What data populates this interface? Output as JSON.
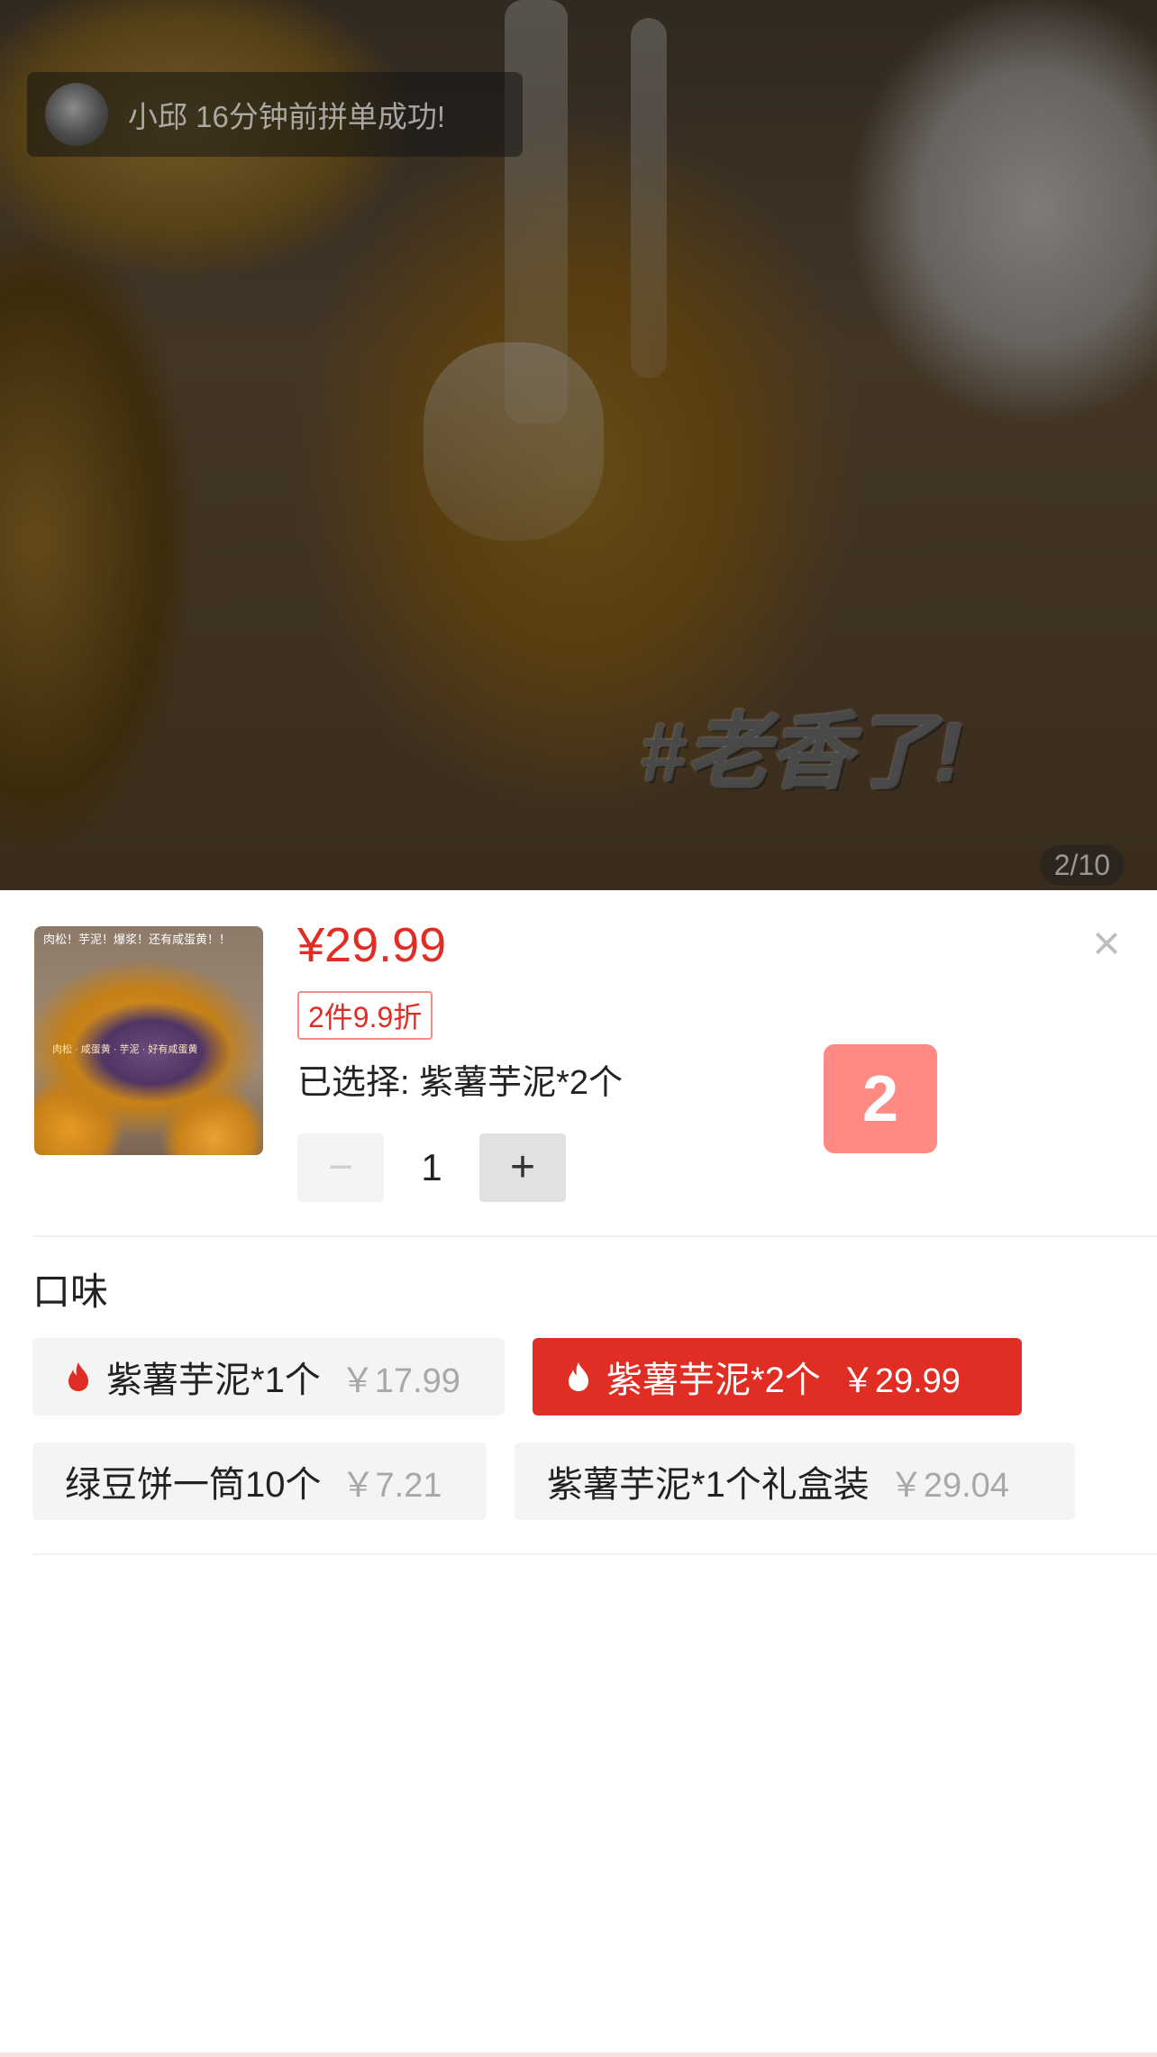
{
  "hero": {
    "notice_text": "小邱 16分钟前拼单成功!",
    "caption": "#老香了!",
    "pager": "2/10"
  },
  "thumbnail": {
    "overlay_text": "肉松！芋泥！爆浆！还有咸蛋黄！！",
    "overlay_text_2": "肉松 · 咸蛋黄 · 芋泥 · 好有咸蛋黄"
  },
  "product": {
    "price": "¥29.99",
    "promo": "2件9.9折",
    "selected": "已选择: 紫薯芋泥*2个"
  },
  "stepper": {
    "minus": "−",
    "quantity": "1",
    "plus": "+"
  },
  "badge": "2",
  "close_icon": "×",
  "flavor": {
    "title": "口味",
    "options": [
      {
        "name": "紫薯芋泥*1个",
        "price": "￥17.99",
        "hot": true,
        "selected": false
      },
      {
        "name": "紫薯芋泥*2个",
        "price": "￥29.99",
        "hot": true,
        "selected": true
      },
      {
        "name": "绿豆饼一筒10个",
        "price": "￥7.21",
        "hot": false,
        "selected": false
      },
      {
        "name": "紫薯芋泥*1个礼盒装",
        "price": "￥29.04",
        "hot": false,
        "selected": false
      }
    ]
  },
  "colors": {
    "accent": "#e02e24",
    "badge": "#ff8a84"
  },
  "icons": [
    "fire-icon",
    "close-icon",
    "minus-icon",
    "plus-icon"
  ]
}
